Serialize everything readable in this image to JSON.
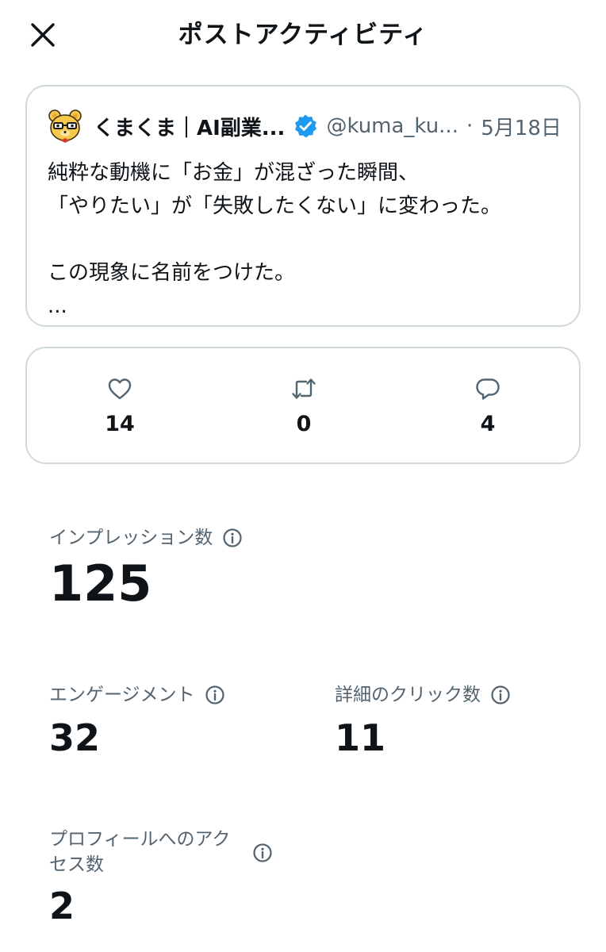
{
  "header": {
    "title": "ポストアクティビティ",
    "close_icon": "close-icon"
  },
  "post": {
    "display_name": "くまくま｜AI副業...",
    "handle": "@kuma_ku...",
    "separator": "·",
    "date": "5月18日",
    "verified_color": "#1d9bf0",
    "lines": [
      "純粋な動機に「お金」が混ざった瞬間、",
      "「やりたい」が「失敗したくない」に変わった。",
      "",
      "この現象に名前をつけた。",
      "..."
    ]
  },
  "engagement": {
    "likes": "14",
    "reposts": "0",
    "replies": "4"
  },
  "metrics": {
    "impressions": {
      "label": "インプレッション数",
      "value": "125"
    },
    "engagements": {
      "label": "エンゲージメント",
      "value": "32"
    },
    "detail_clicks": {
      "label": "詳細のクリック数",
      "value": "11"
    },
    "profile_visits": {
      "label": "プロフィールへのアクセス数",
      "value": "2"
    }
  },
  "colors": {
    "text": "#0f1419",
    "secondary": "#536471",
    "border": "#cfd9de",
    "accent": "#1d9bf0"
  }
}
